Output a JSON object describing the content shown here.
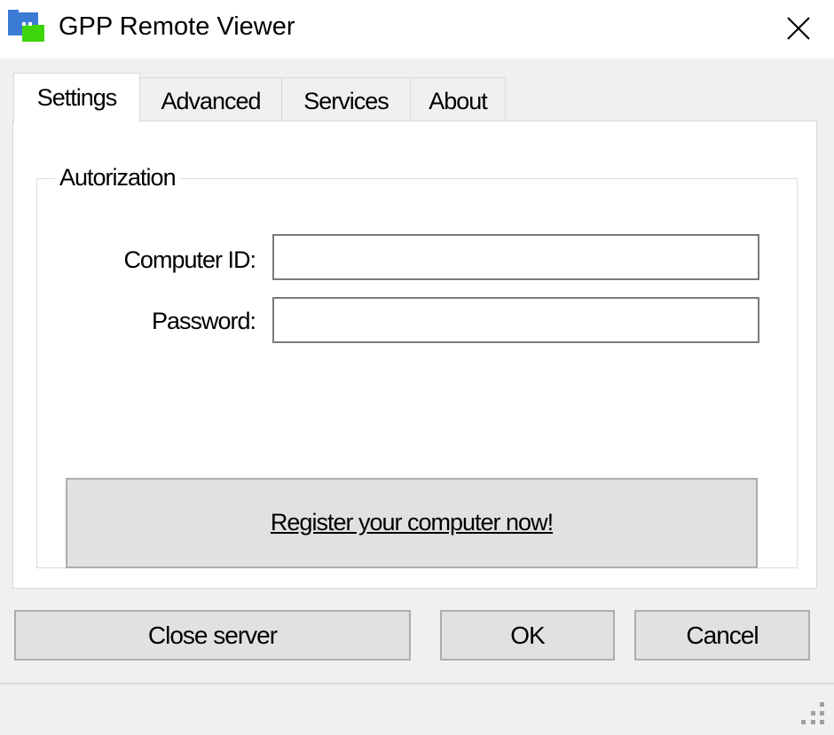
{
  "window": {
    "title": "GPP Remote Viewer",
    "icon": "app-monitor-icon",
    "close_icon": "close-icon"
  },
  "tabs": [
    {
      "label": "Settings",
      "active": true
    },
    {
      "label": "Advanced",
      "active": false
    },
    {
      "label": "Services",
      "active": false
    },
    {
      "label": "About",
      "active": false
    }
  ],
  "settings": {
    "group_title": "Autorization",
    "computer_id": {
      "label": "Computer ID:",
      "value": "",
      "placeholder": ""
    },
    "password": {
      "label": "Password:",
      "value": "",
      "placeholder": ""
    },
    "register_link": "Register your computer now!"
  },
  "buttons": {
    "close_server": "Close server",
    "ok": "OK",
    "cancel": "Cancel"
  },
  "statusbar": {
    "grip_icon": "resize-grip-icon"
  },
  "colors": {
    "window_bg": "#f0f0f0",
    "titlebar_bg": "#ffffff",
    "button_bg": "#e1e1e1",
    "button_border": "#adadad",
    "icon_blue": "#3b7bd6",
    "icon_green": "#3ed40a"
  }
}
